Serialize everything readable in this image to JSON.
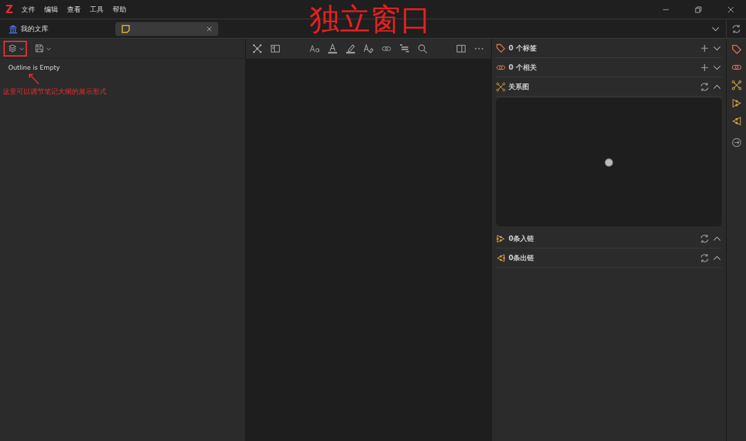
{
  "logo": "Z",
  "menu": [
    "文件",
    "编辑",
    "查看",
    "工具",
    "帮助"
  ],
  "tabs": [
    {
      "kind": "library",
      "label": "我的文库",
      "selected": false
    },
    {
      "kind": "note",
      "selected": true
    }
  ],
  "outline": {
    "message": "Outline is Empty"
  },
  "annotations": {
    "title": "独立窗口",
    "note": "这里可以调节笔记大纲的展示形式"
  },
  "sections": [
    {
      "kind": "tags",
      "label": "0 个标签",
      "expanded": false
    },
    {
      "kind": "related",
      "label": "0 个相关",
      "expanded": false
    },
    {
      "kind": "graph",
      "label": "关系图",
      "expanded": true
    },
    {
      "kind": "inlinks",
      "label": "0条入链",
      "expanded": true
    },
    {
      "kind": "outlinks",
      "label": "0条出链",
      "expanded": true
    }
  ]
}
